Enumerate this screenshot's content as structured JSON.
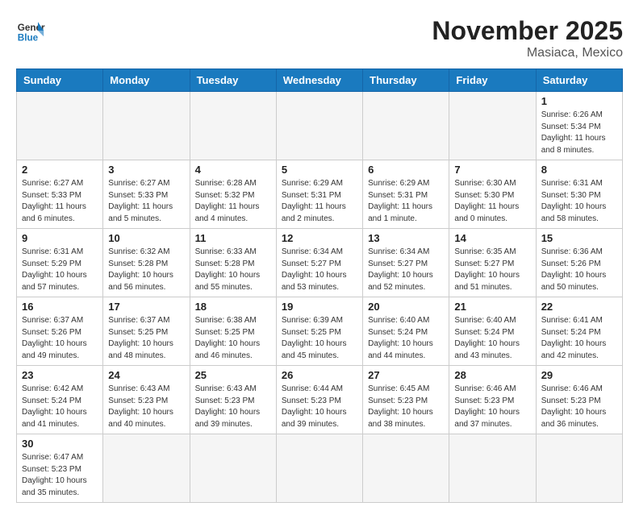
{
  "header": {
    "logo_general": "General",
    "logo_blue": "Blue",
    "month_title": "November 2025",
    "location": "Masiaca, Mexico"
  },
  "days_of_week": [
    "Sunday",
    "Monday",
    "Tuesday",
    "Wednesday",
    "Thursday",
    "Friday",
    "Saturday"
  ],
  "weeks": [
    [
      {
        "day": "",
        "info": ""
      },
      {
        "day": "",
        "info": ""
      },
      {
        "day": "",
        "info": ""
      },
      {
        "day": "",
        "info": ""
      },
      {
        "day": "",
        "info": ""
      },
      {
        "day": "",
        "info": ""
      },
      {
        "day": "1",
        "info": "Sunrise: 6:26 AM\nSunset: 5:34 PM\nDaylight: 11 hours and 8 minutes."
      }
    ],
    [
      {
        "day": "2",
        "info": "Sunrise: 6:27 AM\nSunset: 5:33 PM\nDaylight: 11 hours and 6 minutes."
      },
      {
        "day": "3",
        "info": "Sunrise: 6:27 AM\nSunset: 5:33 PM\nDaylight: 11 hours and 5 minutes."
      },
      {
        "day": "4",
        "info": "Sunrise: 6:28 AM\nSunset: 5:32 PM\nDaylight: 11 hours and 4 minutes."
      },
      {
        "day": "5",
        "info": "Sunrise: 6:29 AM\nSunset: 5:31 PM\nDaylight: 11 hours and 2 minutes."
      },
      {
        "day": "6",
        "info": "Sunrise: 6:29 AM\nSunset: 5:31 PM\nDaylight: 11 hours and 1 minute."
      },
      {
        "day": "7",
        "info": "Sunrise: 6:30 AM\nSunset: 5:30 PM\nDaylight: 11 hours and 0 minutes."
      },
      {
        "day": "8",
        "info": "Sunrise: 6:31 AM\nSunset: 5:30 PM\nDaylight: 10 hours and 58 minutes."
      }
    ],
    [
      {
        "day": "9",
        "info": "Sunrise: 6:31 AM\nSunset: 5:29 PM\nDaylight: 10 hours and 57 minutes."
      },
      {
        "day": "10",
        "info": "Sunrise: 6:32 AM\nSunset: 5:28 PM\nDaylight: 10 hours and 56 minutes."
      },
      {
        "day": "11",
        "info": "Sunrise: 6:33 AM\nSunset: 5:28 PM\nDaylight: 10 hours and 55 minutes."
      },
      {
        "day": "12",
        "info": "Sunrise: 6:34 AM\nSunset: 5:27 PM\nDaylight: 10 hours and 53 minutes."
      },
      {
        "day": "13",
        "info": "Sunrise: 6:34 AM\nSunset: 5:27 PM\nDaylight: 10 hours and 52 minutes."
      },
      {
        "day": "14",
        "info": "Sunrise: 6:35 AM\nSunset: 5:27 PM\nDaylight: 10 hours and 51 minutes."
      },
      {
        "day": "15",
        "info": "Sunrise: 6:36 AM\nSunset: 5:26 PM\nDaylight: 10 hours and 50 minutes."
      }
    ],
    [
      {
        "day": "16",
        "info": "Sunrise: 6:37 AM\nSunset: 5:26 PM\nDaylight: 10 hours and 49 minutes."
      },
      {
        "day": "17",
        "info": "Sunrise: 6:37 AM\nSunset: 5:25 PM\nDaylight: 10 hours and 48 minutes."
      },
      {
        "day": "18",
        "info": "Sunrise: 6:38 AM\nSunset: 5:25 PM\nDaylight: 10 hours and 46 minutes."
      },
      {
        "day": "19",
        "info": "Sunrise: 6:39 AM\nSunset: 5:25 PM\nDaylight: 10 hours and 45 minutes."
      },
      {
        "day": "20",
        "info": "Sunrise: 6:40 AM\nSunset: 5:24 PM\nDaylight: 10 hours and 44 minutes."
      },
      {
        "day": "21",
        "info": "Sunrise: 6:40 AM\nSunset: 5:24 PM\nDaylight: 10 hours and 43 minutes."
      },
      {
        "day": "22",
        "info": "Sunrise: 6:41 AM\nSunset: 5:24 PM\nDaylight: 10 hours and 42 minutes."
      }
    ],
    [
      {
        "day": "23",
        "info": "Sunrise: 6:42 AM\nSunset: 5:24 PM\nDaylight: 10 hours and 41 minutes."
      },
      {
        "day": "24",
        "info": "Sunrise: 6:43 AM\nSunset: 5:23 PM\nDaylight: 10 hours and 40 minutes."
      },
      {
        "day": "25",
        "info": "Sunrise: 6:43 AM\nSunset: 5:23 PM\nDaylight: 10 hours and 39 minutes."
      },
      {
        "day": "26",
        "info": "Sunrise: 6:44 AM\nSunset: 5:23 PM\nDaylight: 10 hours and 39 minutes."
      },
      {
        "day": "27",
        "info": "Sunrise: 6:45 AM\nSunset: 5:23 PM\nDaylight: 10 hours and 38 minutes."
      },
      {
        "day": "28",
        "info": "Sunrise: 6:46 AM\nSunset: 5:23 PM\nDaylight: 10 hours and 37 minutes."
      },
      {
        "day": "29",
        "info": "Sunrise: 6:46 AM\nSunset: 5:23 PM\nDaylight: 10 hours and 36 minutes."
      }
    ],
    [
      {
        "day": "30",
        "info": "Sunrise: 6:47 AM\nSunset: 5:23 PM\nDaylight: 10 hours and 35 minutes."
      },
      {
        "day": "",
        "info": ""
      },
      {
        "day": "",
        "info": ""
      },
      {
        "day": "",
        "info": ""
      },
      {
        "day": "",
        "info": ""
      },
      {
        "day": "",
        "info": ""
      },
      {
        "day": "",
        "info": ""
      }
    ]
  ]
}
